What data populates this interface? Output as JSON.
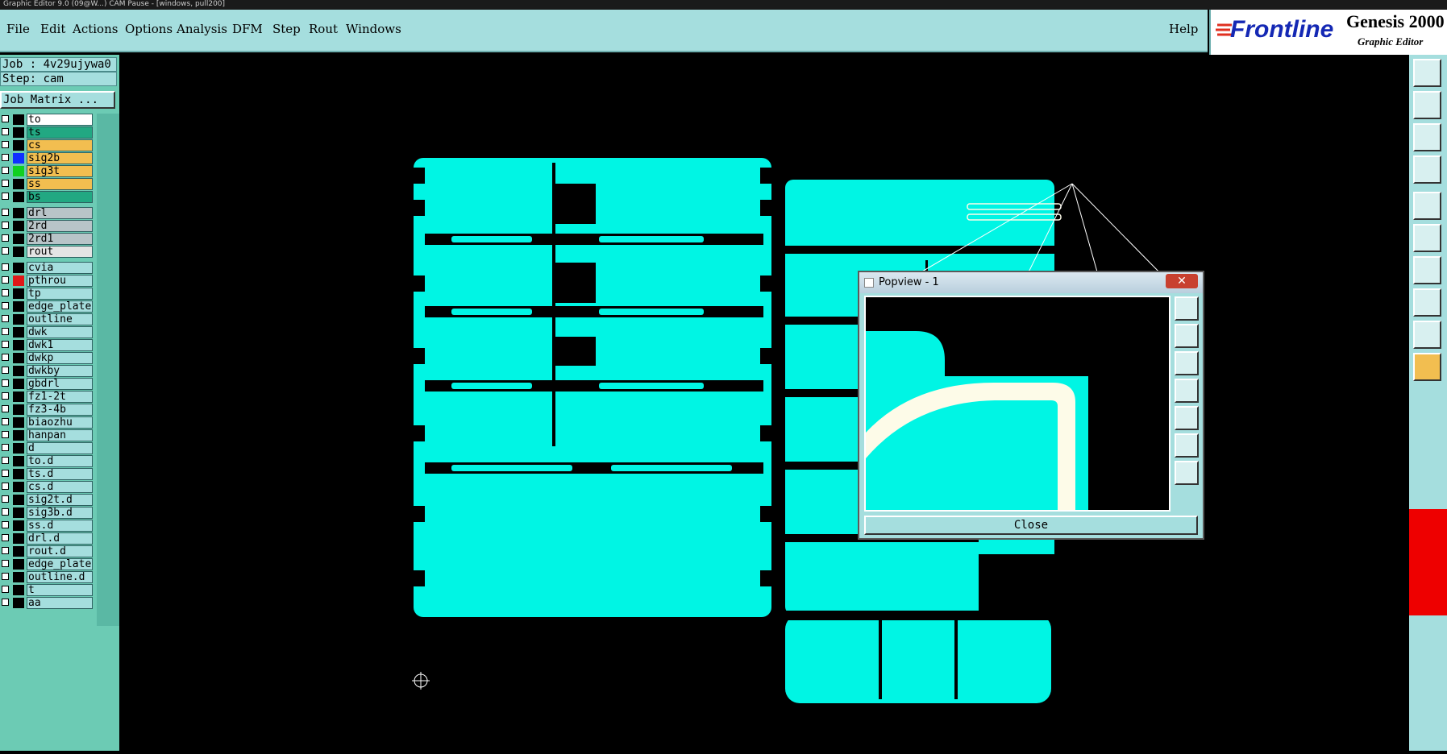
{
  "window": {
    "title": "Graphic Editor 9.0 (09@W...) CAM Pause - [windows, pull200]"
  },
  "menu": {
    "items": [
      {
        "label": "File"
      },
      {
        "label": "Edit"
      },
      {
        "label": "Actions"
      },
      {
        "label": "Options"
      },
      {
        "label": "Analysis"
      },
      {
        "label": "DFM"
      },
      {
        "label": "Step"
      },
      {
        "label": "Rout"
      },
      {
        "label": "Windows"
      }
    ],
    "help": "Help"
  },
  "logo": {
    "brand": "Frontline",
    "product": "Genesis 2000",
    "subtitle": "Graphic Editor"
  },
  "job": {
    "job_label": "Job : 4v29ujywa0",
    "step_label": "Step: cam",
    "matrix_button": "Job Matrix ..."
  },
  "layers": [
    {
      "name": "to",
      "swatch": "#000000",
      "bg": "#ffffff"
    },
    {
      "name": "ts",
      "swatch": "#000000",
      "bg": "#22a882"
    },
    {
      "name": "cs",
      "swatch": "#000000",
      "bg": "#f2be50"
    },
    {
      "name": "sig2b",
      "swatch": "#1030ff",
      "bg": "#f2be50"
    },
    {
      "name": "sig3t",
      "swatch": "#10d020",
      "bg": "#f2be50"
    },
    {
      "name": "ss",
      "swatch": "#000000",
      "bg": "#f2be50"
    },
    {
      "name": "bs",
      "swatch": "#000000",
      "bg": "#22a882"
    },
    {
      "name": "drl",
      "swatch": "#000000",
      "bg": "#b8c4c8"
    },
    {
      "name": "2rd",
      "swatch": "#000000",
      "bg": "#b8c4c8"
    },
    {
      "name": "2rd1",
      "swatch": "#000000",
      "bg": "#b8c4c8"
    },
    {
      "name": "rout",
      "swatch": "#000000",
      "bg": "#e4e4e4"
    },
    {
      "name": "cvia",
      "swatch": "#000000",
      "bg": "#a5dede"
    },
    {
      "name": "pthrou",
      "swatch": "#e01818",
      "bg": "#a5dede"
    },
    {
      "name": "tp",
      "swatch": "#000000",
      "bg": "#a5dede"
    },
    {
      "name": "edge_plated",
      "swatch": "#000000",
      "bg": "#a5dede"
    },
    {
      "name": "outline",
      "swatch": "#000000",
      "bg": "#a5dede"
    },
    {
      "name": "dwk",
      "swatch": "#000000",
      "bg": "#a5dede"
    },
    {
      "name": "dwk1",
      "swatch": "#000000",
      "bg": "#a5dede"
    },
    {
      "name": "dwkp",
      "swatch": "#000000",
      "bg": "#a5dede"
    },
    {
      "name": "dwkby",
      "swatch": "#000000",
      "bg": "#a5dede"
    },
    {
      "name": "gbdrl",
      "swatch": "#000000",
      "bg": "#a5dede"
    },
    {
      "name": "fz1-2t",
      "swatch": "#000000",
      "bg": "#a5dede"
    },
    {
      "name": "fz3-4b",
      "swatch": "#000000",
      "bg": "#a5dede"
    },
    {
      "name": "biaozhu",
      "swatch": "#000000",
      "bg": "#a5dede"
    },
    {
      "name": "hanpan",
      "swatch": "#000000",
      "bg": "#a5dede"
    },
    {
      "name": "d",
      "swatch": "#000000",
      "bg": "#a5dede"
    },
    {
      "name": "to.d",
      "swatch": "#000000",
      "bg": "#a5dede"
    },
    {
      "name": "ts.d",
      "swatch": "#000000",
      "bg": "#a5dede"
    },
    {
      "name": "cs.d",
      "swatch": "#000000",
      "bg": "#a5dede"
    },
    {
      "name": "sig2t.d",
      "swatch": "#000000",
      "bg": "#a5dede"
    },
    {
      "name": "sig3b.d",
      "swatch": "#000000",
      "bg": "#a5dede"
    },
    {
      "name": "ss.d",
      "swatch": "#000000",
      "bg": "#a5dede"
    },
    {
      "name": "drl.d",
      "swatch": "#000000",
      "bg": "#a5dede"
    },
    {
      "name": "rout.d",
      "swatch": "#000000",
      "bg": "#a5dede"
    },
    {
      "name": "edge_plated",
      "swatch": "#000000",
      "bg": "#a5dede"
    },
    {
      "name": "outline.d",
      "swatch": "#000000",
      "bg": "#a5dede"
    },
    {
      "name": "t",
      "swatch": "#000000",
      "bg": "#a5dede"
    },
    {
      "name": "aa",
      "swatch": "#000000",
      "bg": "#a5dede"
    }
  ],
  "popview": {
    "title": "Popview - 1",
    "close_x": "✕",
    "close_button": "Close"
  },
  "colors": {
    "panel": "#a5dede",
    "board": "#00f5e4",
    "rout_path": "#fdfbe8"
  },
  "tools": [
    "pan-icon",
    "zoom-icon",
    "fit-icon",
    "route-icon",
    "snap-icon",
    "net-icon",
    "measure-icon",
    "select-icon",
    "drc-icon",
    "pointer-icon"
  ]
}
